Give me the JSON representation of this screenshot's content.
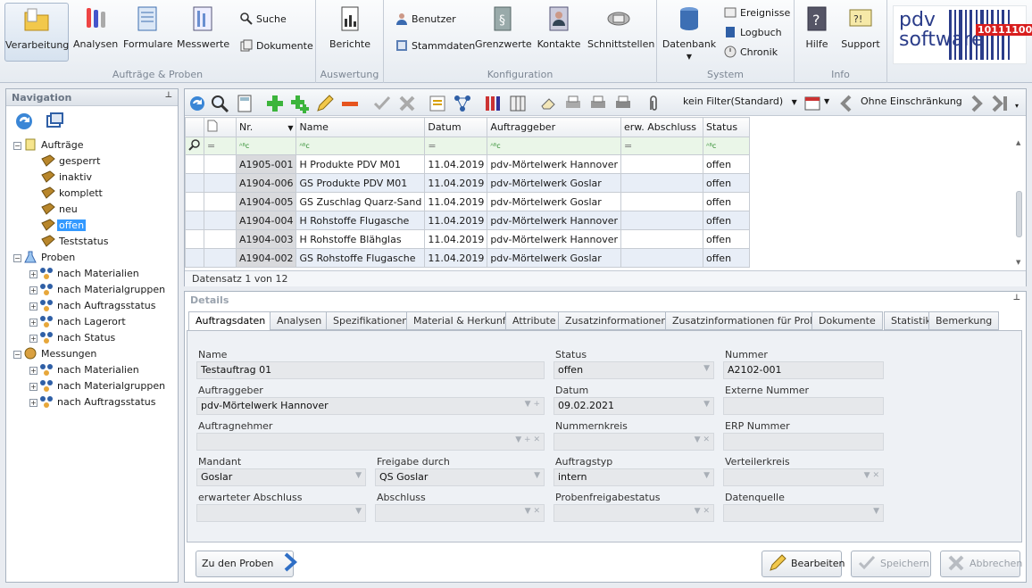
{
  "ribbon": {
    "groups": [
      {
        "label": "Aufträge & Proben"
      },
      {
        "label": "Auswertung"
      },
      {
        "label": "Konfiguration"
      },
      {
        "label": "System"
      },
      {
        "label": "Info"
      }
    ],
    "verarbeitung": "Verarbeitung",
    "analysen": "Analysen",
    "formulare": "Formulare",
    "messwerte": "Messwerte",
    "suche": "Suche",
    "dokumente": "Dokumente",
    "berichte": "Berichte",
    "benutzer": "Benutzer",
    "stammdaten": "Stammdaten",
    "grenzwerte": "Grenzwerte",
    "kontakte": "Kontakte",
    "schnittstellen": "Schnittstellen",
    "datenbank": "Datenbank",
    "ereignisse": "Ereignisse",
    "logbuch": "Logbuch",
    "chronik": "Chronik",
    "hilfe": "Hilfe",
    "support": "Support"
  },
  "logo": {
    "line1": "pdv",
    "line2": "software",
    "badge": "10111100"
  },
  "navigation": {
    "title": "Navigation",
    "tree": [
      {
        "label": "Aufträge",
        "level": 0,
        "expander": "−"
      },
      {
        "label": "gesperrt",
        "level": 1
      },
      {
        "label": "inaktiv",
        "level": 1
      },
      {
        "label": "komplett",
        "level": 1
      },
      {
        "label": "neu",
        "level": 1
      },
      {
        "label": "offen",
        "level": 1,
        "selected": true
      },
      {
        "label": "Teststatus",
        "level": 1
      },
      {
        "label": "Proben",
        "level": 0,
        "expander": "−"
      },
      {
        "label": "nach Materialien",
        "level": 1,
        "expander": "+"
      },
      {
        "label": "nach Materialgruppen",
        "level": 1,
        "expander": "+"
      },
      {
        "label": "nach Auftragsstatus",
        "level": 1,
        "expander": "+"
      },
      {
        "label": "nach Lagerort",
        "level": 1,
        "expander": "+"
      },
      {
        "label": "nach Status",
        "level": 1,
        "expander": "+"
      },
      {
        "label": "Messungen",
        "level": 0,
        "expander": "−"
      },
      {
        "label": "nach Materialien",
        "level": 1,
        "expander": "+"
      },
      {
        "label": "nach Materialgruppen",
        "level": 1,
        "expander": "+"
      },
      {
        "label": "nach Auftragsstatus",
        "level": 1,
        "expander": "+"
      }
    ]
  },
  "grid": {
    "filter_label": "kein Filter(Standard)",
    "restriction_label": "Ohne Einschränkung",
    "columns": [
      "Nr.",
      "Name",
      "Datum",
      "Auftraggeber",
      "erw. Abschluss",
      "Status"
    ],
    "filter_ops": [
      "=",
      "ᴬᴮc",
      "ᴬᴮc",
      "=",
      "ᴬᴮc",
      "=",
      "ᴬᴮc"
    ],
    "rows": [
      [
        "A1905-001",
        "H Produkte PDV M01",
        "11.04.2019",
        "pdv-Mörtelwerk Hannover",
        "",
        "offen"
      ],
      [
        "A1904-006",
        "GS Produkte PDV M01",
        "11.04.2019",
        "pdv-Mörtelwerk Goslar",
        "",
        "offen"
      ],
      [
        "A1904-005",
        "GS Zuschlag Quarz-Sand",
        "11.04.2019",
        "pdv-Mörtelwerk Goslar",
        "",
        "offen"
      ],
      [
        "A1904-004",
        "H Rohstoffe Flugasche",
        "11.04.2019",
        "pdv-Mörtelwerk Hannover",
        "",
        "offen"
      ],
      [
        "A1904-003",
        "H Rohstoffe Blähglas",
        "11.04.2019",
        "pdv-Mörtelwerk Hannover",
        "",
        "offen"
      ],
      [
        "A1904-002",
        "GS Rohstoffe Flugasche",
        "11.04.2019",
        "pdv-Mörtelwerk Goslar",
        "",
        "offen"
      ]
    ],
    "record_status": "Datensatz 1 von 12"
  },
  "details": {
    "title": "Details",
    "tabs": [
      "Auftragsdaten",
      "Analysen",
      "Spezifikationen",
      "Material & Herkunft",
      "Attribute",
      "Zusatzinformationen",
      "Zusatzinformationen für Proben",
      "Dokumente",
      "Statistik",
      "Bemerkung"
    ],
    "fields": {
      "name": {
        "label": "Name",
        "value": "Testauftrag 01"
      },
      "status": {
        "label": "Status",
        "value": "offen"
      },
      "nummer": {
        "label": "Nummer",
        "value": "A2102-001"
      },
      "auftraggeber": {
        "label": "Auftraggeber",
        "value": "pdv-Mörtelwerk Hannover"
      },
      "datum": {
        "label": "Datum",
        "value": "09.02.2021"
      },
      "externe_nummer": {
        "label": "Externe Nummer",
        "value": ""
      },
      "auftragnehmer": {
        "label": "Auftragnehmer",
        "value": ""
      },
      "nummernkreis": {
        "label": "Nummernkreis",
        "value": ""
      },
      "erp_nummer": {
        "label": "ERP Nummer",
        "value": ""
      },
      "mandant": {
        "label": "Mandant",
        "value": "Goslar"
      },
      "freigabe": {
        "label": "Freigabe durch",
        "value": "QS Goslar"
      },
      "auftragstyp": {
        "label": "Auftragstyp",
        "value": "intern"
      },
      "verteilerkreis": {
        "label": "Verteilerkreis",
        "value": ""
      },
      "erw_abschluss": {
        "label": "erwarteter Abschluss",
        "value": ""
      },
      "abschluss": {
        "label": "Abschluss",
        "value": ""
      },
      "probenfreigabe": {
        "label": "Probenfreigabestatus",
        "value": ""
      },
      "datenquelle": {
        "label": "Datenquelle",
        "value": ""
      }
    },
    "buttons": {
      "zu_den_proben": "Zu den Proben",
      "bearbeiten": "Bearbeiten",
      "speichern": "Speichern",
      "abbrechen": "Abbrechen"
    }
  }
}
